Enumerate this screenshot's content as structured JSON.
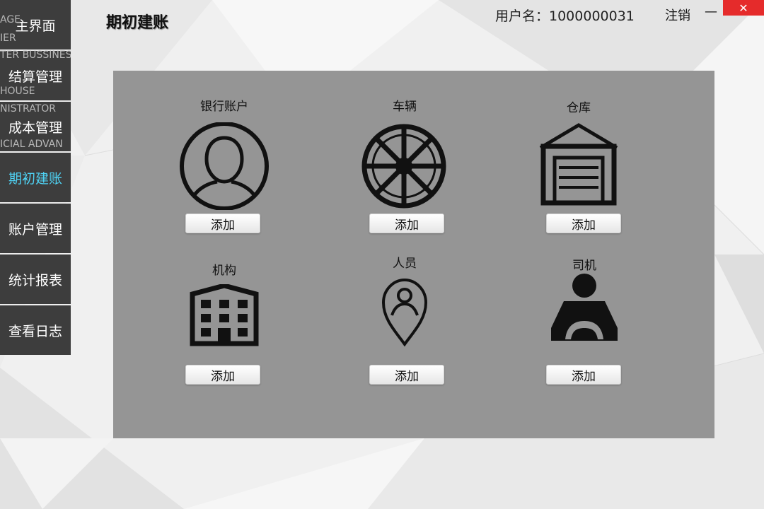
{
  "sidebar": {
    "items": [
      {
        "label": "主界面",
        "active": false
      },
      {
        "label": "结算管理",
        "active": false
      },
      {
        "label": "成本管理",
        "active": false
      },
      {
        "label": "期初建账",
        "active": true
      },
      {
        "label": "账户管理",
        "active": false
      },
      {
        "label": "统计报表",
        "active": false
      },
      {
        "label": "查看日志",
        "active": false
      }
    ],
    "ghost_texts": [
      "AGE",
      "IER",
      "TER BUSSINES",
      "HOUSE",
      "NISTRATOR",
      "ICIAL ADVAN"
    ]
  },
  "header": {
    "title": "期初建账",
    "user_label": "用户名：1000000031",
    "logout_label": "注销",
    "minimize_label": "—",
    "close_label": "✕"
  },
  "panel": {
    "cards": [
      {
        "label": "银行账户",
        "icon": "user-circle-icon",
        "button": "添加"
      },
      {
        "label": "车辆",
        "icon": "wheel-icon",
        "button": "添加"
      },
      {
        "label": "仓库",
        "icon": "warehouse-icon",
        "button": "添加"
      },
      {
        "label": "机构",
        "icon": "building-icon",
        "button": "添加"
      },
      {
        "label": "人员",
        "icon": "person-pin-icon",
        "button": "添加"
      },
      {
        "label": "司机",
        "icon": "driver-icon",
        "button": "添加"
      }
    ]
  },
  "colors": {
    "sidebar_bg": "#3d3d3d",
    "active_nav": "#4fd3f5",
    "panel_bg": "#959595",
    "close_bg": "#e52b2b"
  }
}
